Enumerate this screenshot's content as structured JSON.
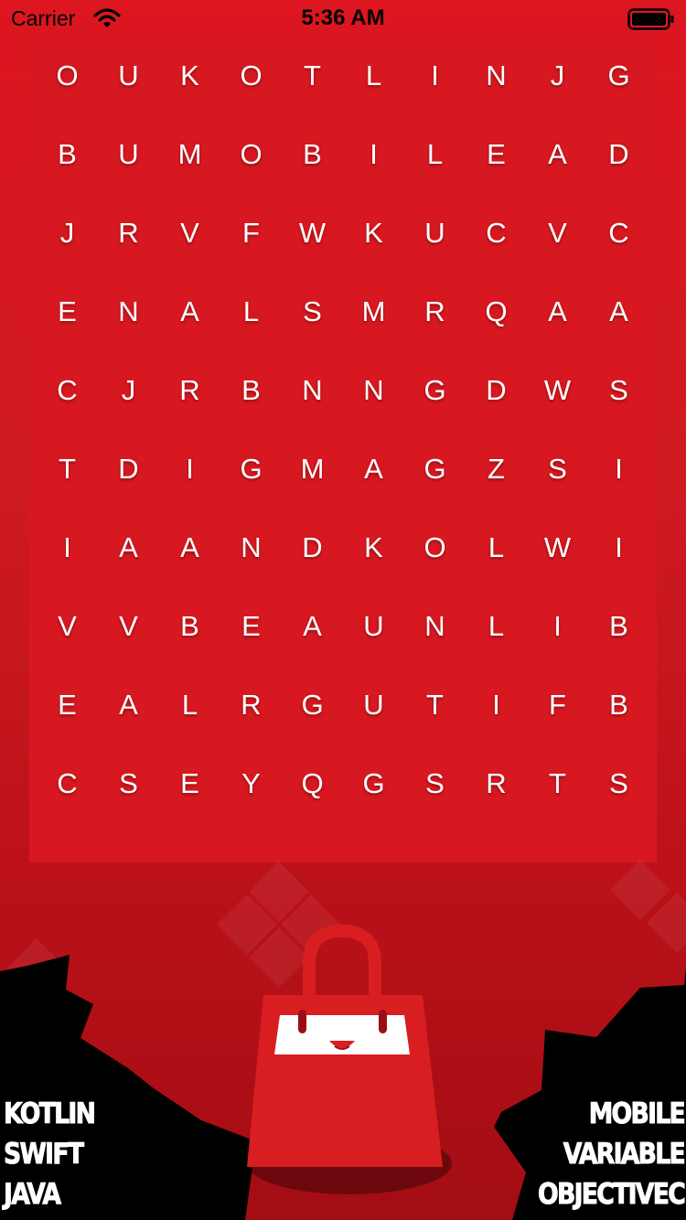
{
  "status_bar": {
    "carrier": "Carrier",
    "time": "5:36 AM",
    "icons": [
      "wifi-icon",
      "battery-icon"
    ]
  },
  "grid": {
    "rows": [
      [
        "O",
        "U",
        "K",
        "O",
        "T",
        "L",
        "I",
        "N",
        "J",
        "G"
      ],
      [
        "B",
        "U",
        "M",
        "O",
        "B",
        "I",
        "L",
        "E",
        "A",
        "D"
      ],
      [
        "J",
        "R",
        "V",
        "F",
        "W",
        "K",
        "U",
        "C",
        "V",
        "C"
      ],
      [
        "E",
        "N",
        "A",
        "L",
        "S",
        "M",
        "R",
        "Q",
        "A",
        "A"
      ],
      [
        "C",
        "J",
        "R",
        "B",
        "N",
        "N",
        "G",
        "D",
        "W",
        "S"
      ],
      [
        "T",
        "D",
        "I",
        "G",
        "M",
        "A",
        "G",
        "Z",
        "S",
        "I"
      ],
      [
        "I",
        "A",
        "A",
        "N",
        "D",
        "K",
        "O",
        "L",
        "W",
        "I"
      ],
      [
        "V",
        "V",
        "B",
        "E",
        "A",
        "U",
        "N",
        "L",
        "I",
        "B"
      ],
      [
        "E",
        "A",
        "L",
        "R",
        "G",
        "U",
        "T",
        "I",
        "F",
        "B"
      ],
      [
        "C",
        "S",
        "E",
        "Y",
        "Q",
        "G",
        "S",
        "R",
        "T",
        "S"
      ]
    ]
  },
  "words": {
    "left": [
      "KOTLIN",
      "SWIFT",
      "JAVA"
    ],
    "right": [
      "MOBILE",
      "VARIABLE",
      "OBJECTIVEC"
    ]
  },
  "colors": {
    "background": "#d01820",
    "board": "#d81820",
    "letters": "#ffffff",
    "silhouettes": "#000000",
    "bag": "#d81e20"
  },
  "decor": {
    "mascot": "shopping-bag-mascot-icon"
  }
}
